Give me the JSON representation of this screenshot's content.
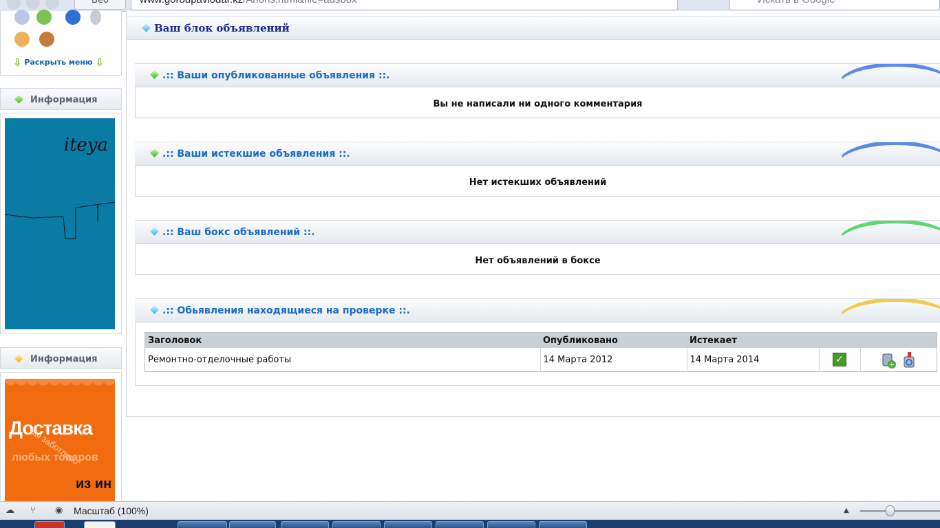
{
  "browser": {
    "tab_label": "Вео",
    "url_host": "www.gorodpavlodar.kz",
    "url_path": "/Anons.html&file=adsbox",
    "search_placeholder": "Искать в Google"
  },
  "left_menu": {
    "expand_label": "Раскрыть меню"
  },
  "sidebar": {
    "info1_title": "Информация",
    "info2_title": "Информация",
    "banner1_brand": "iteya",
    "banner2_line1": "Доставка",
    "banner2_line2": "любых товаров",
    "banner2_line3": "из ин",
    "banner2_overlay": "Вы заботливо"
  },
  "main": {
    "title": "Ваш блок объявлений",
    "sections": [
      {
        "title": ".:: Ваши опубликованные объявления ::.",
        "message": "Вы не написали ни одного комментария"
      },
      {
        "title": ".:: Ваши истекшие объявления ::.",
        "message": "Нет истекших объявлений"
      },
      {
        "title": ".:: Ваш бокс объявлений ::.",
        "message": "Нет объявлений в боксе"
      },
      {
        "title": ".:: Обьявления находящиеся на проверке ::."
      }
    ],
    "table": {
      "headers": [
        "Заголовок",
        "Опубликовано",
        "Истекает"
      ],
      "rows": [
        {
          "title": "Ремонтно-отделочные работы",
          "published": "14 Марта 2012",
          "expires": "14 Марта 2014"
        }
      ]
    }
  },
  "statusbar": {
    "zoom_label": "Масштаб (100%)"
  },
  "colors": {
    "accent_blue": "#1a6cc4",
    "title_navy": "#1c2a8a",
    "swoosh_green": "#5fd57a",
    "swoosh_blue": "#5b8ae8",
    "swoosh_yellow": "#f0cd4a"
  }
}
